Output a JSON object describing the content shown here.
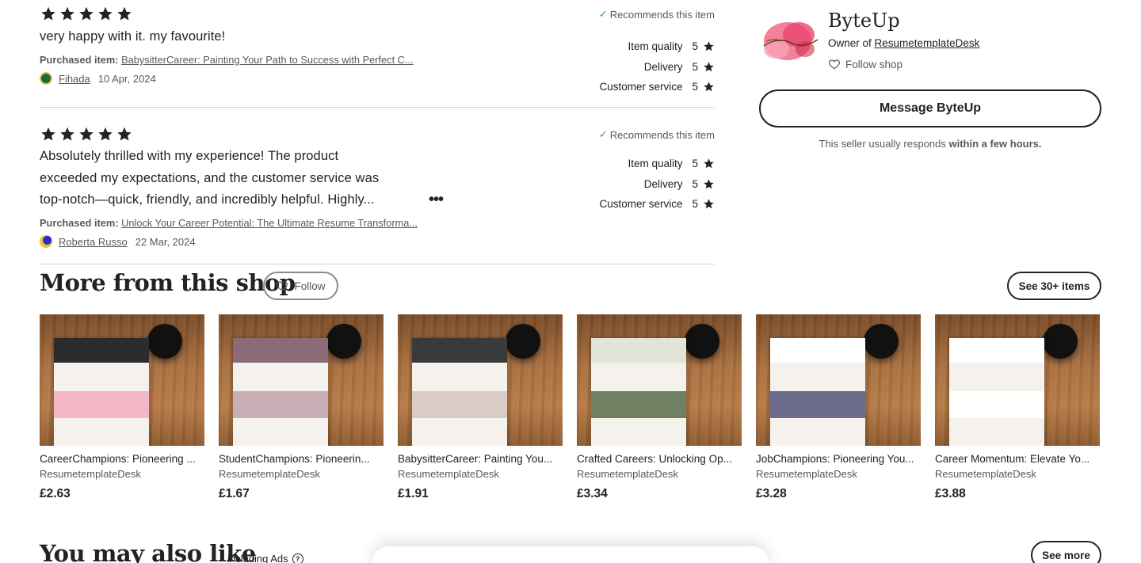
{
  "reviews": [
    {
      "rating": 5,
      "text": "very happy with it. my favourite!",
      "purchased_label": "Purchased item:",
      "purchased_item": "BabysitterCareer: Painting Your Path to Success with Perfect C...",
      "reviewer": "Fihada",
      "date": "10 Apr, 2024",
      "recommends": "Recommends this item",
      "ratings": [
        {
          "label": "Item quality",
          "value": "5"
        },
        {
          "label": "Delivery",
          "value": "5"
        },
        {
          "label": "Customer service",
          "value": "5"
        }
      ]
    },
    {
      "rating": 5,
      "text_lines": [
        "Absolutely thrilled with my experience! The product",
        "exceeded my expectations, and the customer service was",
        "top-notch—quick, friendly, and incredibly helpful. Highly..."
      ],
      "more": "•••",
      "purchased_label": "Purchased item:",
      "purchased_item": "Unlock Your Career Potential: The Ultimate Resume Transforma...",
      "reviewer": "Roberta Russo",
      "date": "22 Mar, 2024",
      "recommends": "Recommends this item",
      "ratings": [
        {
          "label": "Item quality",
          "value": "5"
        },
        {
          "label": "Delivery",
          "value": "5"
        },
        {
          "label": "Customer service",
          "value": "5"
        }
      ]
    }
  ],
  "seller": {
    "name": "ByteUp",
    "owner_prefix": "Owner of ",
    "shop": "ResumetemplateDesk",
    "follow": "Follow shop",
    "message_button": "Message ByteUp",
    "responds_prefix": "This seller usually responds ",
    "responds_time": "within a few hours."
  },
  "more_from_shop": {
    "title": "More from this shop",
    "follow": "Follow",
    "see_items": "See 30+ items",
    "items": [
      {
        "title": "CareerChampions: Pioneering ...",
        "shop": "ResumetemplateDesk",
        "price": "£2.63",
        "accent": "#f2b8c6",
        "header": "#2b2b2b"
      },
      {
        "title": "StudentChampions: Pioneerin...",
        "shop": "ResumetemplateDesk",
        "price": "£1.67",
        "accent": "#c9aeb7",
        "header": "#8c6b78"
      },
      {
        "title": "BabysitterCareer: Painting You...",
        "shop": "ResumetemplateDesk",
        "price": "£1.91",
        "accent": "#d8ccc4",
        "header": "#3a3a3a"
      },
      {
        "title": "Crafted Careers: Unlocking Op...",
        "shop": "ResumetemplateDesk",
        "price": "£3.34",
        "accent": "#6f8063",
        "header": "#dfe6d8"
      },
      {
        "title": "JobChampions: Pioneering You...",
        "shop": "ResumetemplateDesk",
        "price": "£3.28",
        "accent": "#6b6b8c",
        "header": "#ffffff"
      },
      {
        "title": "Career Momentum: Elevate Yo...",
        "shop": "ResumetemplateDesk",
        "price": "£3.88",
        "accent": "#ffffff",
        "header": "#ffffff"
      }
    ]
  },
  "also_like": {
    "title": "You may also like",
    "subtitle": "including Ads",
    "help": "?",
    "see_more": "See more"
  },
  "colors": {
    "star": "#222222",
    "check": "#3e9a59"
  }
}
